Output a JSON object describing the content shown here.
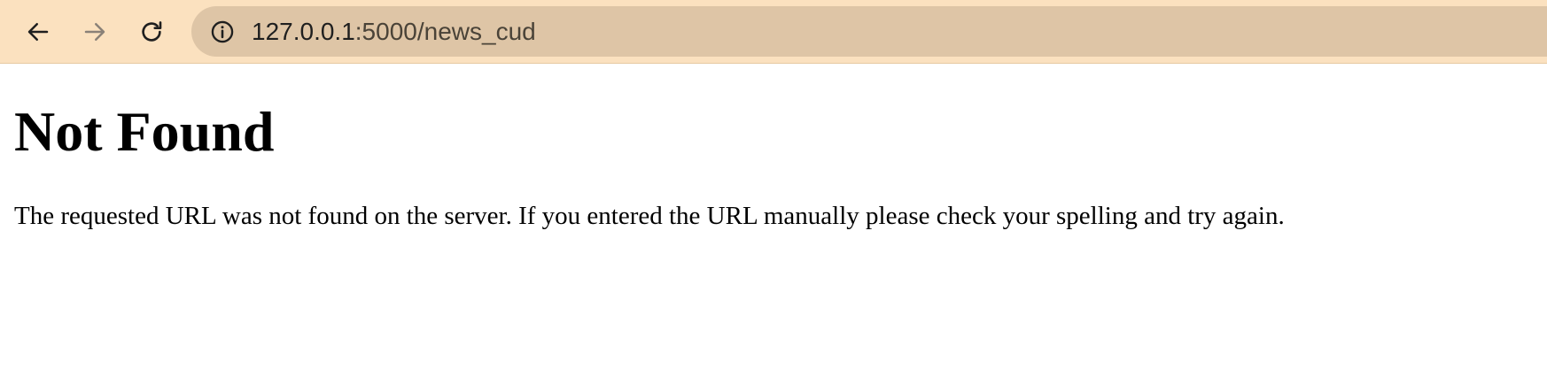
{
  "browser": {
    "toolbar_color": "#fbe1bf",
    "omnibox_color": "#dec5a6",
    "nav": {
      "back_icon": "arrow-left-icon",
      "forward_icon": "arrow-right-icon",
      "reload_icon": "reload-icon"
    },
    "address_bar": {
      "site_info_icon": "info-circle-icon",
      "url_host": "127.0.0.1",
      "url_path": ":5000/news_cud"
    }
  },
  "page": {
    "title": "Not Found",
    "message": "The requested URL was not found on the server. If you entered the URL manually please check your spelling and try again."
  }
}
